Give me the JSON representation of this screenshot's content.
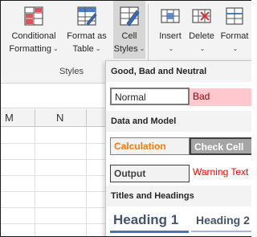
{
  "ribbon": {
    "conditional_formatting": {
      "line1": "Conditional",
      "line2": "Formatting",
      "chevron": "⌄"
    },
    "format_as_table": {
      "line1": "Format as",
      "line2": "Table",
      "chevron": "⌄"
    },
    "cell_styles": {
      "line1": "Cell",
      "line2": "Styles",
      "chevron": "⌄"
    },
    "insert": {
      "line1": "Insert",
      "chevron": "⌄"
    },
    "delete": {
      "line1": "Delete",
      "chevron": "⌄"
    },
    "format": {
      "line1": "Format",
      "chevron": "⌄"
    },
    "group_label": "Styles"
  },
  "sheet": {
    "columns": [
      "M",
      "N"
    ]
  },
  "gallery": {
    "sections": {
      "good_bad_neutral": "Good, Bad and Neutral",
      "data_model": "Data and Model",
      "titles_headings": "Titles and Headings"
    },
    "styles": {
      "normal": "Normal",
      "bad": "Bad",
      "calculation": "Calculation",
      "check_cell": "Check Cell",
      "output": "Output",
      "warning_text": "Warning Text",
      "heading1": "Heading 1",
      "heading2": "Heading 2"
    }
  },
  "colors": {
    "bad_fill": "#ffc7ce",
    "bad_text": "#9c0006",
    "calculation_text": "#fa7d00",
    "check_cell_fill": "#a5a5a5",
    "warning_text": "#ff0000",
    "heading_text": "#44546a",
    "heading_underline": "#4472c4"
  }
}
